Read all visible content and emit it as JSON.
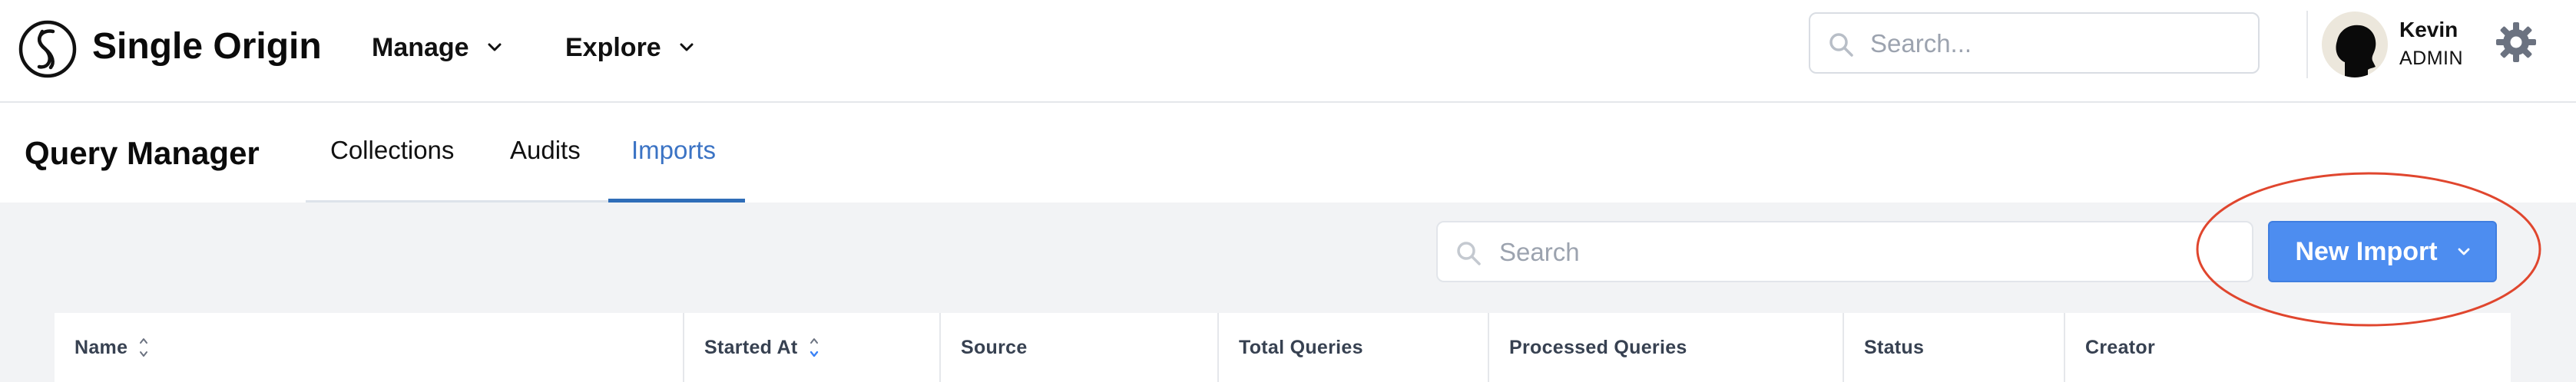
{
  "app": {
    "brand": "Single Origin",
    "nav": [
      {
        "label": "Manage"
      },
      {
        "label": "Explore"
      }
    ],
    "search_placeholder": "Search...",
    "user": {
      "name": "Kevin",
      "role": "ADMIN"
    }
  },
  "page": {
    "title": "Query Manager",
    "tabs": [
      {
        "label": "Collections",
        "active": false
      },
      {
        "label": "Audits",
        "active": false
      },
      {
        "label": "Imports",
        "active": true
      }
    ]
  },
  "toolbar": {
    "search_placeholder": "Search",
    "new_import_label": "New Import"
  },
  "table": {
    "columns": [
      {
        "label": "Name",
        "sortable": true
      },
      {
        "label": "Started At",
        "sortable": true,
        "sorted": "desc"
      },
      {
        "label": "Source",
        "sortable": false
      },
      {
        "label": "Total Queries",
        "sortable": false
      },
      {
        "label": "Processed Queries",
        "sortable": false
      },
      {
        "label": "Status",
        "sortable": false
      },
      {
        "label": "Creator",
        "sortable": false
      }
    ]
  },
  "colors": {
    "accent": "#4d8df0",
    "active_tab": "#3b73c4",
    "annotation_ring": "#e0462e",
    "content_bg": "#f2f3f5"
  },
  "icons": {
    "logo": "single-origin-logo",
    "search": "search-icon",
    "chevron": "chevron-down-icon",
    "settings": "gear-icon",
    "sort": "sort-icon"
  }
}
